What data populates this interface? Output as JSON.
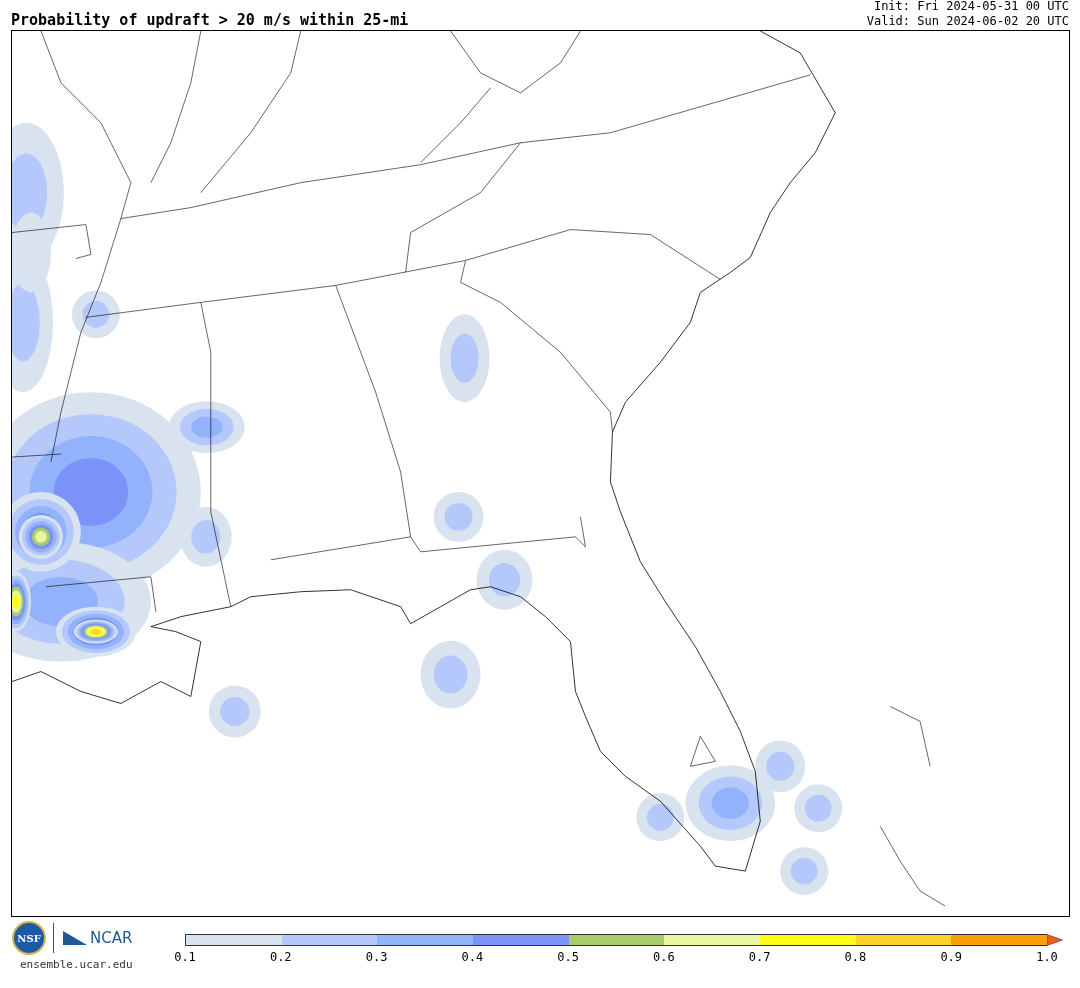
{
  "title": "Probability of updraft > 20 m/s within 25-mi",
  "init": "Init: Fri 2024-05-31 00 UTC",
  "valid": "Valid: Sun 2024-06-02 20 UTC",
  "logos": {
    "nsf": "NSF",
    "ncar": "NCAR"
  },
  "site": "ensemble.ucar.edu",
  "colorbar": {
    "bins": [
      {
        "color": "#d9e3ef"
      },
      {
        "color": "#b4c8fb"
      },
      {
        "color": "#93b2fc"
      },
      {
        "color": "#7b93f8"
      },
      {
        "color": "#a9cd6a"
      },
      {
        "color": "#e8f5a3"
      },
      {
        "color": "#fffc1a"
      },
      {
        "color": "#fdd22a"
      },
      {
        "color": "#fb9e0a"
      }
    ],
    "extend": {
      "color": "#f05a1a"
    },
    "ticks": [
      "0.1",
      "0.2",
      "0.3",
      "0.4",
      "0.5",
      "0.6",
      "0.7",
      "0.8",
      "0.9",
      "1.0"
    ]
  }
}
